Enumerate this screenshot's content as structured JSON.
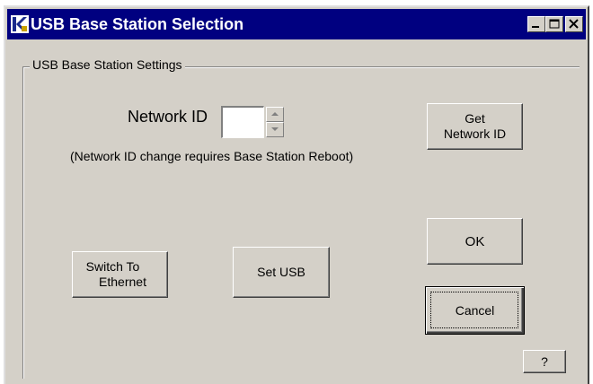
{
  "window": {
    "title": "USB Base Station Selection",
    "buttons": {
      "minimize": "minimize",
      "maximize": "maximize",
      "close": "close"
    }
  },
  "group": {
    "label": "USB Base Station Settings"
  },
  "network_id": {
    "label": "Network ID",
    "value": "",
    "note": "(Network ID change requires Base Station Reboot)"
  },
  "buttons": {
    "get_network_id": {
      "line1": "Get",
      "line2": "Network ID"
    },
    "ok": "OK",
    "switch_to_ethernet": {
      "line1": "Switch To",
      "line2": "Ethernet"
    },
    "set_usb": "Set USB",
    "cancel": "Cancel",
    "help": "?"
  },
  "icons": {
    "app": "k-logo-icon",
    "spin_up": "arrow-up-icon",
    "spin_down": "arrow-down-icon"
  },
  "colors": {
    "titlebar": "#000080",
    "face": "#d4d0c8",
    "title_text": "#ffffff"
  }
}
